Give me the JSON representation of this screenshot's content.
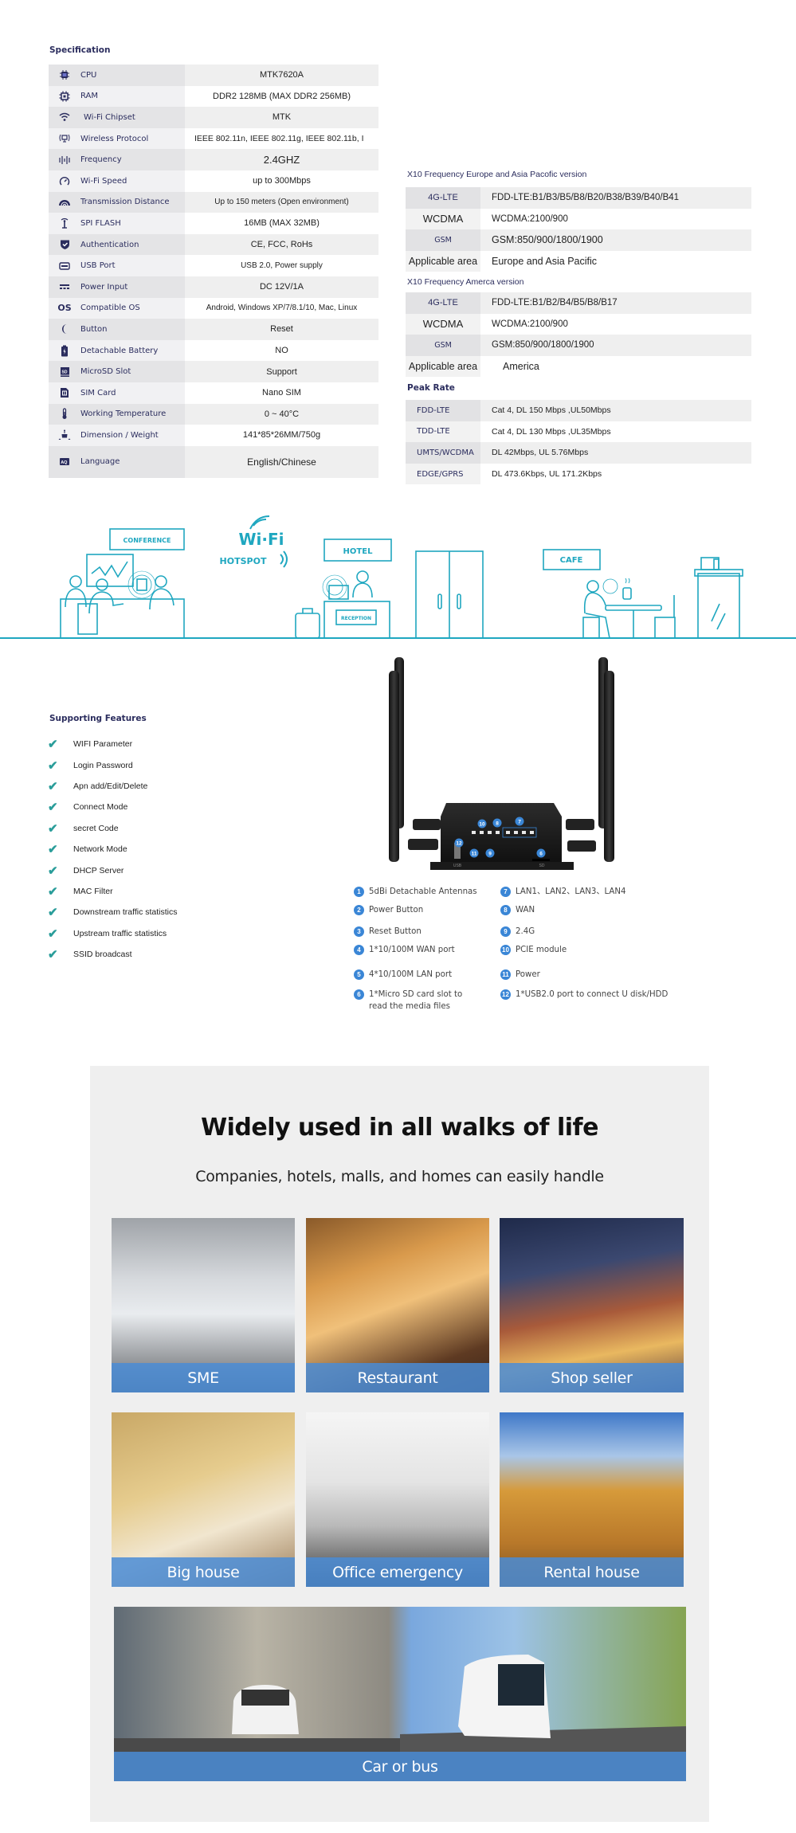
{
  "specification": {
    "title": "Specification",
    "rows": [
      {
        "icon": "cpu-icon",
        "label": "CPU",
        "value": "MTK7620A"
      },
      {
        "icon": "ram-chip-icon",
        "label": "RAM",
        "value": "DDR2 128MB (MAX DDR2 256MB)"
      },
      {
        "icon": "wifi-icon",
        "label": "Wi-Fi Chipset",
        "value": "MTK"
      },
      {
        "icon": "wireless-monitor-icon",
        "label": "Wireless Protocol",
        "value": "IEEE 802.11n, IEEE 802.11g, IEEE 802.11b, I"
      },
      {
        "icon": "frequency-wave-icon",
        "label": "Frequency",
        "value": "2.4GHZ"
      },
      {
        "icon": "speedometer-icon",
        "label": "Wi-Fi Speed",
        "value": "up to 300Mbps"
      },
      {
        "icon": "signal-arc-icon",
        "label": "Transmission Distance",
        "value": "Up to 150 meters (Open environment)"
      },
      {
        "icon": "antenna-icon",
        "label": "SPI FLASH",
        "value": "16MB (MAX 32MB)"
      },
      {
        "icon": "shield-check-icon",
        "label": "Authentication",
        "value": "CE, FCC, RoHs"
      },
      {
        "icon": "usb-port-icon",
        "label": "USB Port",
        "value": "USB 2.0, Power supply"
      },
      {
        "icon": "dc-power-icon",
        "label": "Power Input",
        "value": "DC 12V/1A"
      },
      {
        "icon": "os-text-icon",
        "label": "Compatible  OS",
        "value": "Android, Windows XP/7/8.1/10, Mac, Linux"
      },
      {
        "icon": "moon-button-icon",
        "label": "Button",
        "value": "Reset"
      },
      {
        "icon": "battery-icon",
        "label": "Detachable Battery",
        "value": "NO"
      },
      {
        "icon": "sd-card-icon",
        "label": "MicroSD Slot",
        "value": "Support"
      },
      {
        "icon": "sim-card-icon",
        "label": "SIM Card",
        "value": "Nano SIM"
      },
      {
        "icon": "thermometer-icon",
        "label": "Working Temperature",
        "value": "0 ~ 40°C"
      },
      {
        "icon": "dimension-icon",
        "label": "Dimension / Weight",
        "value": "141*85*26MM/750g"
      },
      {
        "icon": "language-icon",
        "label": "Language",
        "value": "English/Chinese"
      }
    ],
    "os_glyph": "OS"
  },
  "frequency_eu": {
    "title": "X10 Frequency Europe and Asia Pacofic version",
    "rows": [
      {
        "label": "4G-LTE",
        "value": "FDD-LTE:B1/B3/B5/B8/B20/B38/B39/B40/B41"
      },
      {
        "label": "WCDMA",
        "value": "WCDMA:2100/900"
      },
      {
        "label": "GSM",
        "value": "GSM:850/900/1800/1900"
      },
      {
        "label": "Applicable area",
        "value": "Europe and Asia Pacific"
      }
    ]
  },
  "frequency_us": {
    "title": "X10 Frequency Amerca version",
    "rows": [
      {
        "label": "4G-LTE",
        "value": "FDD-LTE:B1/B2/B4/B5/B8/B17"
      },
      {
        "label": "WCDMA",
        "value": "WCDMA:2100/900"
      },
      {
        "label": "GSM",
        "value": "GSM:850/900/1800/1900"
      },
      {
        "label": "Applicable area",
        "value": "America"
      }
    ]
  },
  "peak_rate": {
    "title": "Peak Rate",
    "rows": [
      {
        "label": "FDD-LTE",
        "value": "Cat 4, DL 150 Mbps ,UL50Mbps"
      },
      {
        "label": "TDD-LTE",
        "value": "Cat 4, DL 130 Mbps ,UL35Mbps"
      },
      {
        "label": "UMTS/WCDMA",
        "value": "DL 42Mbps, UL 5.76Mbps"
      },
      {
        "label": "EDGE/GPRS",
        "value": "DL 473.6Kbps, UL 171.2Kbps"
      }
    ]
  },
  "illustration": {
    "conference_label": "CONFERENCE",
    "wifi_label": "Wi·Fi",
    "hotspot_label": "HOTSPOT",
    "hotel_label": "HOTEL",
    "reception_label": "RECEPTION",
    "cafe_label": "CAFE",
    "line_color": "#1fa7c0"
  },
  "features": {
    "title": "Supporting Features",
    "check_color": "#2a9d9a",
    "items": [
      "WIFI Parameter",
      "Login Password",
      "Apn add/Edit/Delete",
      "Connect Mode",
      "secret  Code",
      "Network Mode",
      "DHCP Server",
      "MAC Filter",
      "Downstream traffic statistics",
      "Upstream traffic statistics",
      "SSID broadcast"
    ]
  },
  "router": {
    "callouts": [
      "10",
      "8",
      "7",
      "12",
      "11",
      "9",
      "6"
    ],
    "usb_label": "USB",
    "sd_label": "SD",
    "parts": [
      {
        "num": "1",
        "text": "5dBi Detachable Antennas"
      },
      {
        "num": "2",
        "text": "Power Button"
      },
      {
        "num": "3",
        "text": "Reset Button"
      },
      {
        "num": "4",
        "text": "1*10/100M WAN port"
      },
      {
        "num": "5",
        "text": "4*10/100M LAN port"
      },
      {
        "num": "6",
        "text": "1*Micro SD card slot to read the media files"
      },
      {
        "num": "7",
        "text": "LAN1、LAN2、LAN3、LAN4"
      },
      {
        "num": "8",
        "text": "WAN"
      },
      {
        "num": "9",
        "text": "2.4G"
      },
      {
        "num": "10",
        "text": "PCIE module"
      },
      {
        "num": "11",
        "text": "Power"
      },
      {
        "num": "12",
        "text": "1*USB2.0 port to connect U disk/HDD"
      }
    ]
  },
  "usage": {
    "title": "Widely used in all walks of life",
    "subtitle": "Companies, hotels, malls, and homes can easily handle",
    "caption_color": "#4a8cd6",
    "tiles": [
      {
        "caption": "SME"
      },
      {
        "caption": "Restaurant"
      },
      {
        "caption": "Shop seller"
      },
      {
        "caption": "Big house"
      },
      {
        "caption": "Office emergency"
      },
      {
        "caption": "Rental house"
      },
      {
        "caption": "Car or bus"
      }
    ]
  }
}
